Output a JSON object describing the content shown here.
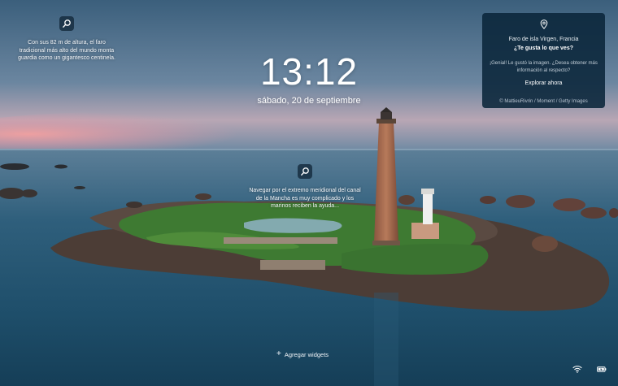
{
  "clock": {
    "time": "13:12",
    "date": "sábado, 20 de septiembre"
  },
  "hotspots": {
    "top_left": {
      "icon": "search-icon",
      "text": "Con sus 82 m de altura, el faro tradicional más alto del mundo monta guardia como un gigantesco centinela."
    },
    "center": {
      "icon": "search-icon",
      "text": "Navegar por el extremo meridional del canal de la Mancha es muy complicado y los marinos reciben la ayuda..."
    }
  },
  "spotlight": {
    "icon": "location-pin-icon",
    "title": "Faro de isla Virgen, Francia",
    "question": "¿Te gusta lo que ves?",
    "description": "¡Genial! Le gustó la imagen. ¿Desea obtener más información al respecto?",
    "explore_label": "Explorar ahora",
    "credit": "© MattieuRivrin / Moment / Getty Images"
  },
  "bottom": {
    "add_widgets_label": "Agregar widgets",
    "add_icon": "plus-icon",
    "wifi_icon": "wifi-icon",
    "battery_icon": "battery-icon"
  },
  "colors": {
    "card_background": "#0a263a",
    "sky_top": "#3b5f7c",
    "horizon_glow": "#e9a4a4",
    "sea": "#1f4f6b",
    "grass": "#3e7a32"
  }
}
